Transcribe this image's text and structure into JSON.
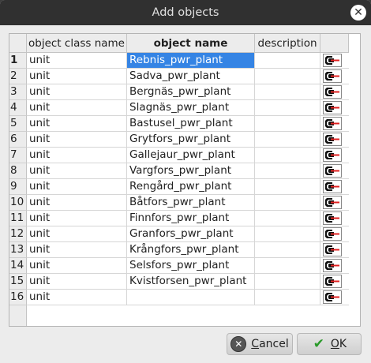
{
  "window": {
    "title": "Add objects"
  },
  "table": {
    "columns": [
      "object class name",
      "object name",
      "description",
      ""
    ],
    "rows": [
      {
        "num": "1",
        "cls": "unit",
        "name": "Rebnis_pwr_plant",
        "desc": ""
      },
      {
        "num": "2",
        "cls": "unit",
        "name": "Sadva_pwr_plant",
        "desc": ""
      },
      {
        "num": "3",
        "cls": "unit",
        "name": "Bergnäs_pwr_plant",
        "desc": ""
      },
      {
        "num": "4",
        "cls": "unit",
        "name": "Slagnäs_pwr_plant",
        "desc": ""
      },
      {
        "num": "5",
        "cls": "unit",
        "name": "Bastusel_pwr_plant",
        "desc": ""
      },
      {
        "num": "6",
        "cls": "unit",
        "name": "Grytfors_pwr_plant",
        "desc": ""
      },
      {
        "num": "7",
        "cls": "unit",
        "name": "Gallejaur_pwr_plant",
        "desc": ""
      },
      {
        "num": "8",
        "cls": "unit",
        "name": "Vargfors_pwr_plant",
        "desc": ""
      },
      {
        "num": "9",
        "cls": "unit",
        "name": "Rengård_pwr_plant",
        "desc": ""
      },
      {
        "num": "10",
        "cls": "unit",
        "name": "Båtfors_pwr_plant",
        "desc": ""
      },
      {
        "num": "11",
        "cls": "unit",
        "name": "Finnfors_pwr_plant",
        "desc": ""
      },
      {
        "num": "12",
        "cls": "unit",
        "name": "Granfors_pwr_plant",
        "desc": ""
      },
      {
        "num": "13",
        "cls": "unit",
        "name": "Krångfors_pwr_plant",
        "desc": ""
      },
      {
        "num": "14",
        "cls": "unit",
        "name": "Selsfors_pwr_plant",
        "desc": ""
      },
      {
        "num": "15",
        "cls": "unit",
        "name": "Kvistforsen_pwr_plant",
        "desc": ""
      },
      {
        "num": "16",
        "cls": "unit",
        "name": "",
        "desc": ""
      }
    ],
    "selected_row": 1,
    "row_icon": "unit-class-icon"
  },
  "buttons": {
    "cancel": {
      "label_u": "C",
      "label_rest": "ancel",
      "icon": "cancel-icon"
    },
    "ok": {
      "label_u": "O",
      "label_rest": "K",
      "icon": "check-icon"
    }
  },
  "colors": {
    "selection": "#3584e4",
    "titlebar": "#303030",
    "icon_red": "#e02020"
  }
}
